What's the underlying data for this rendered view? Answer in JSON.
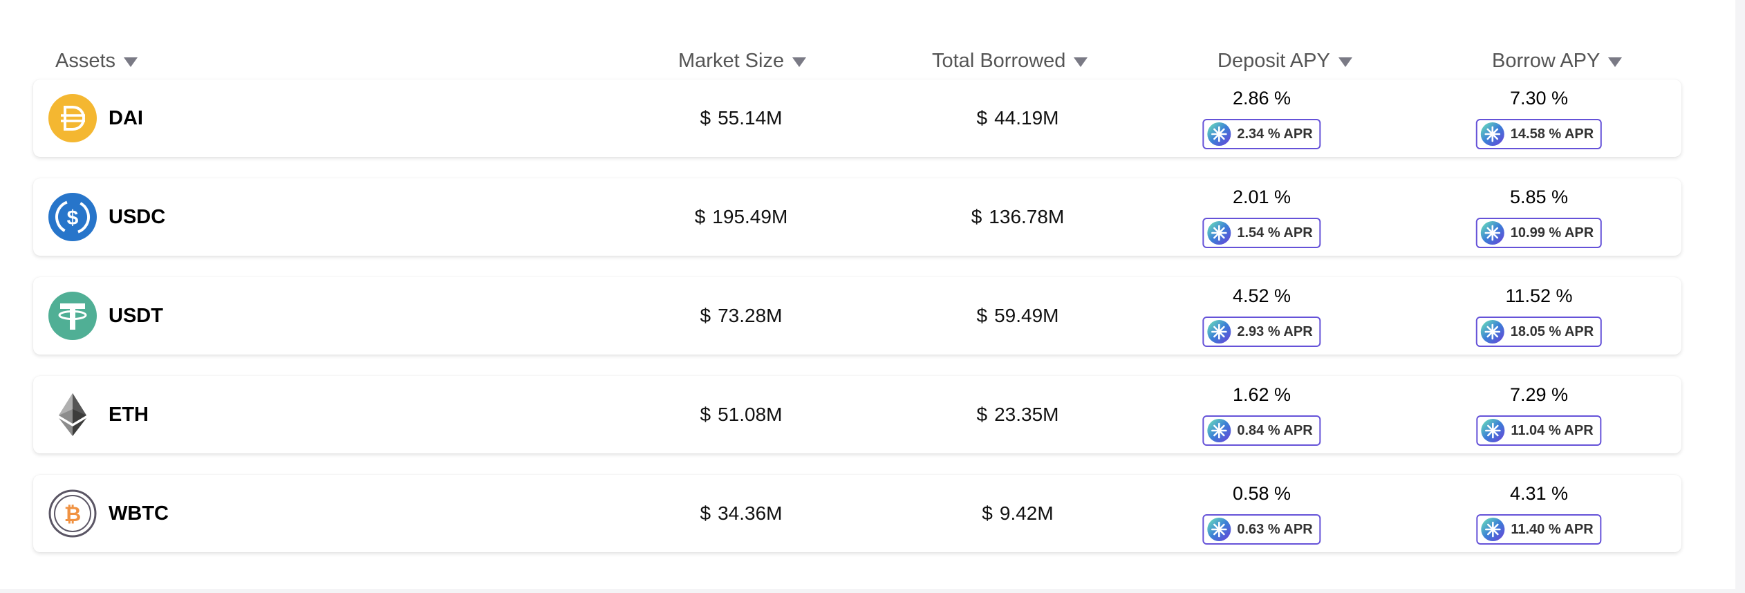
{
  "header": {
    "assets": "Assets",
    "market_size": "Market Size",
    "total_borrowed": "Total Borrowed",
    "deposit_apy": "Deposit APY",
    "borrow_apy": "Borrow APY"
  },
  "currency_symbol": "$",
  "rows": [
    {
      "symbol": "DAI",
      "icon": "dai-icon",
      "market_size": "55.14M",
      "total_borrowed": "44.19M",
      "deposit_apy": "2.86 %",
      "deposit_apr": "2.34 % APR",
      "borrow_apy": "7.30 %",
      "borrow_apr": "14.58 % APR"
    },
    {
      "symbol": "USDC",
      "icon": "usdc-icon",
      "market_size": "195.49M",
      "total_borrowed": "136.78M",
      "deposit_apy": "2.01 %",
      "deposit_apr": "1.54 % APR",
      "borrow_apy": "5.85 %",
      "borrow_apr": "10.99 % APR"
    },
    {
      "symbol": "USDT",
      "icon": "usdt-icon",
      "market_size": "73.28M",
      "total_borrowed": "59.49M",
      "deposit_apy": "4.52 %",
      "deposit_apr": "2.93 % APR",
      "borrow_apy": "11.52 %",
      "borrow_apr": "18.05 % APR"
    },
    {
      "symbol": "ETH",
      "icon": "eth-icon",
      "market_size": "51.08M",
      "total_borrowed": "23.35M",
      "deposit_apy": "1.62 %",
      "deposit_apr": "0.84 % APR",
      "borrow_apy": "7.29 %",
      "borrow_apr": "11.04 % APR"
    },
    {
      "symbol": "WBTC",
      "icon": "wbtc-icon",
      "market_size": "34.36M",
      "total_borrowed": "9.42M",
      "deposit_apy": "0.58 %",
      "deposit_apr": "0.63 % APR",
      "borrow_apy": "4.31 %",
      "borrow_apr": "11.40 % APR"
    }
  ],
  "colors": {
    "apr_border": "#6552d8",
    "dai": "#f4b731",
    "usdc": "#2775ca",
    "usdt": "#50af95",
    "wbtc_ring": "#5a5564",
    "wbtc_btc": "#f09242"
  }
}
